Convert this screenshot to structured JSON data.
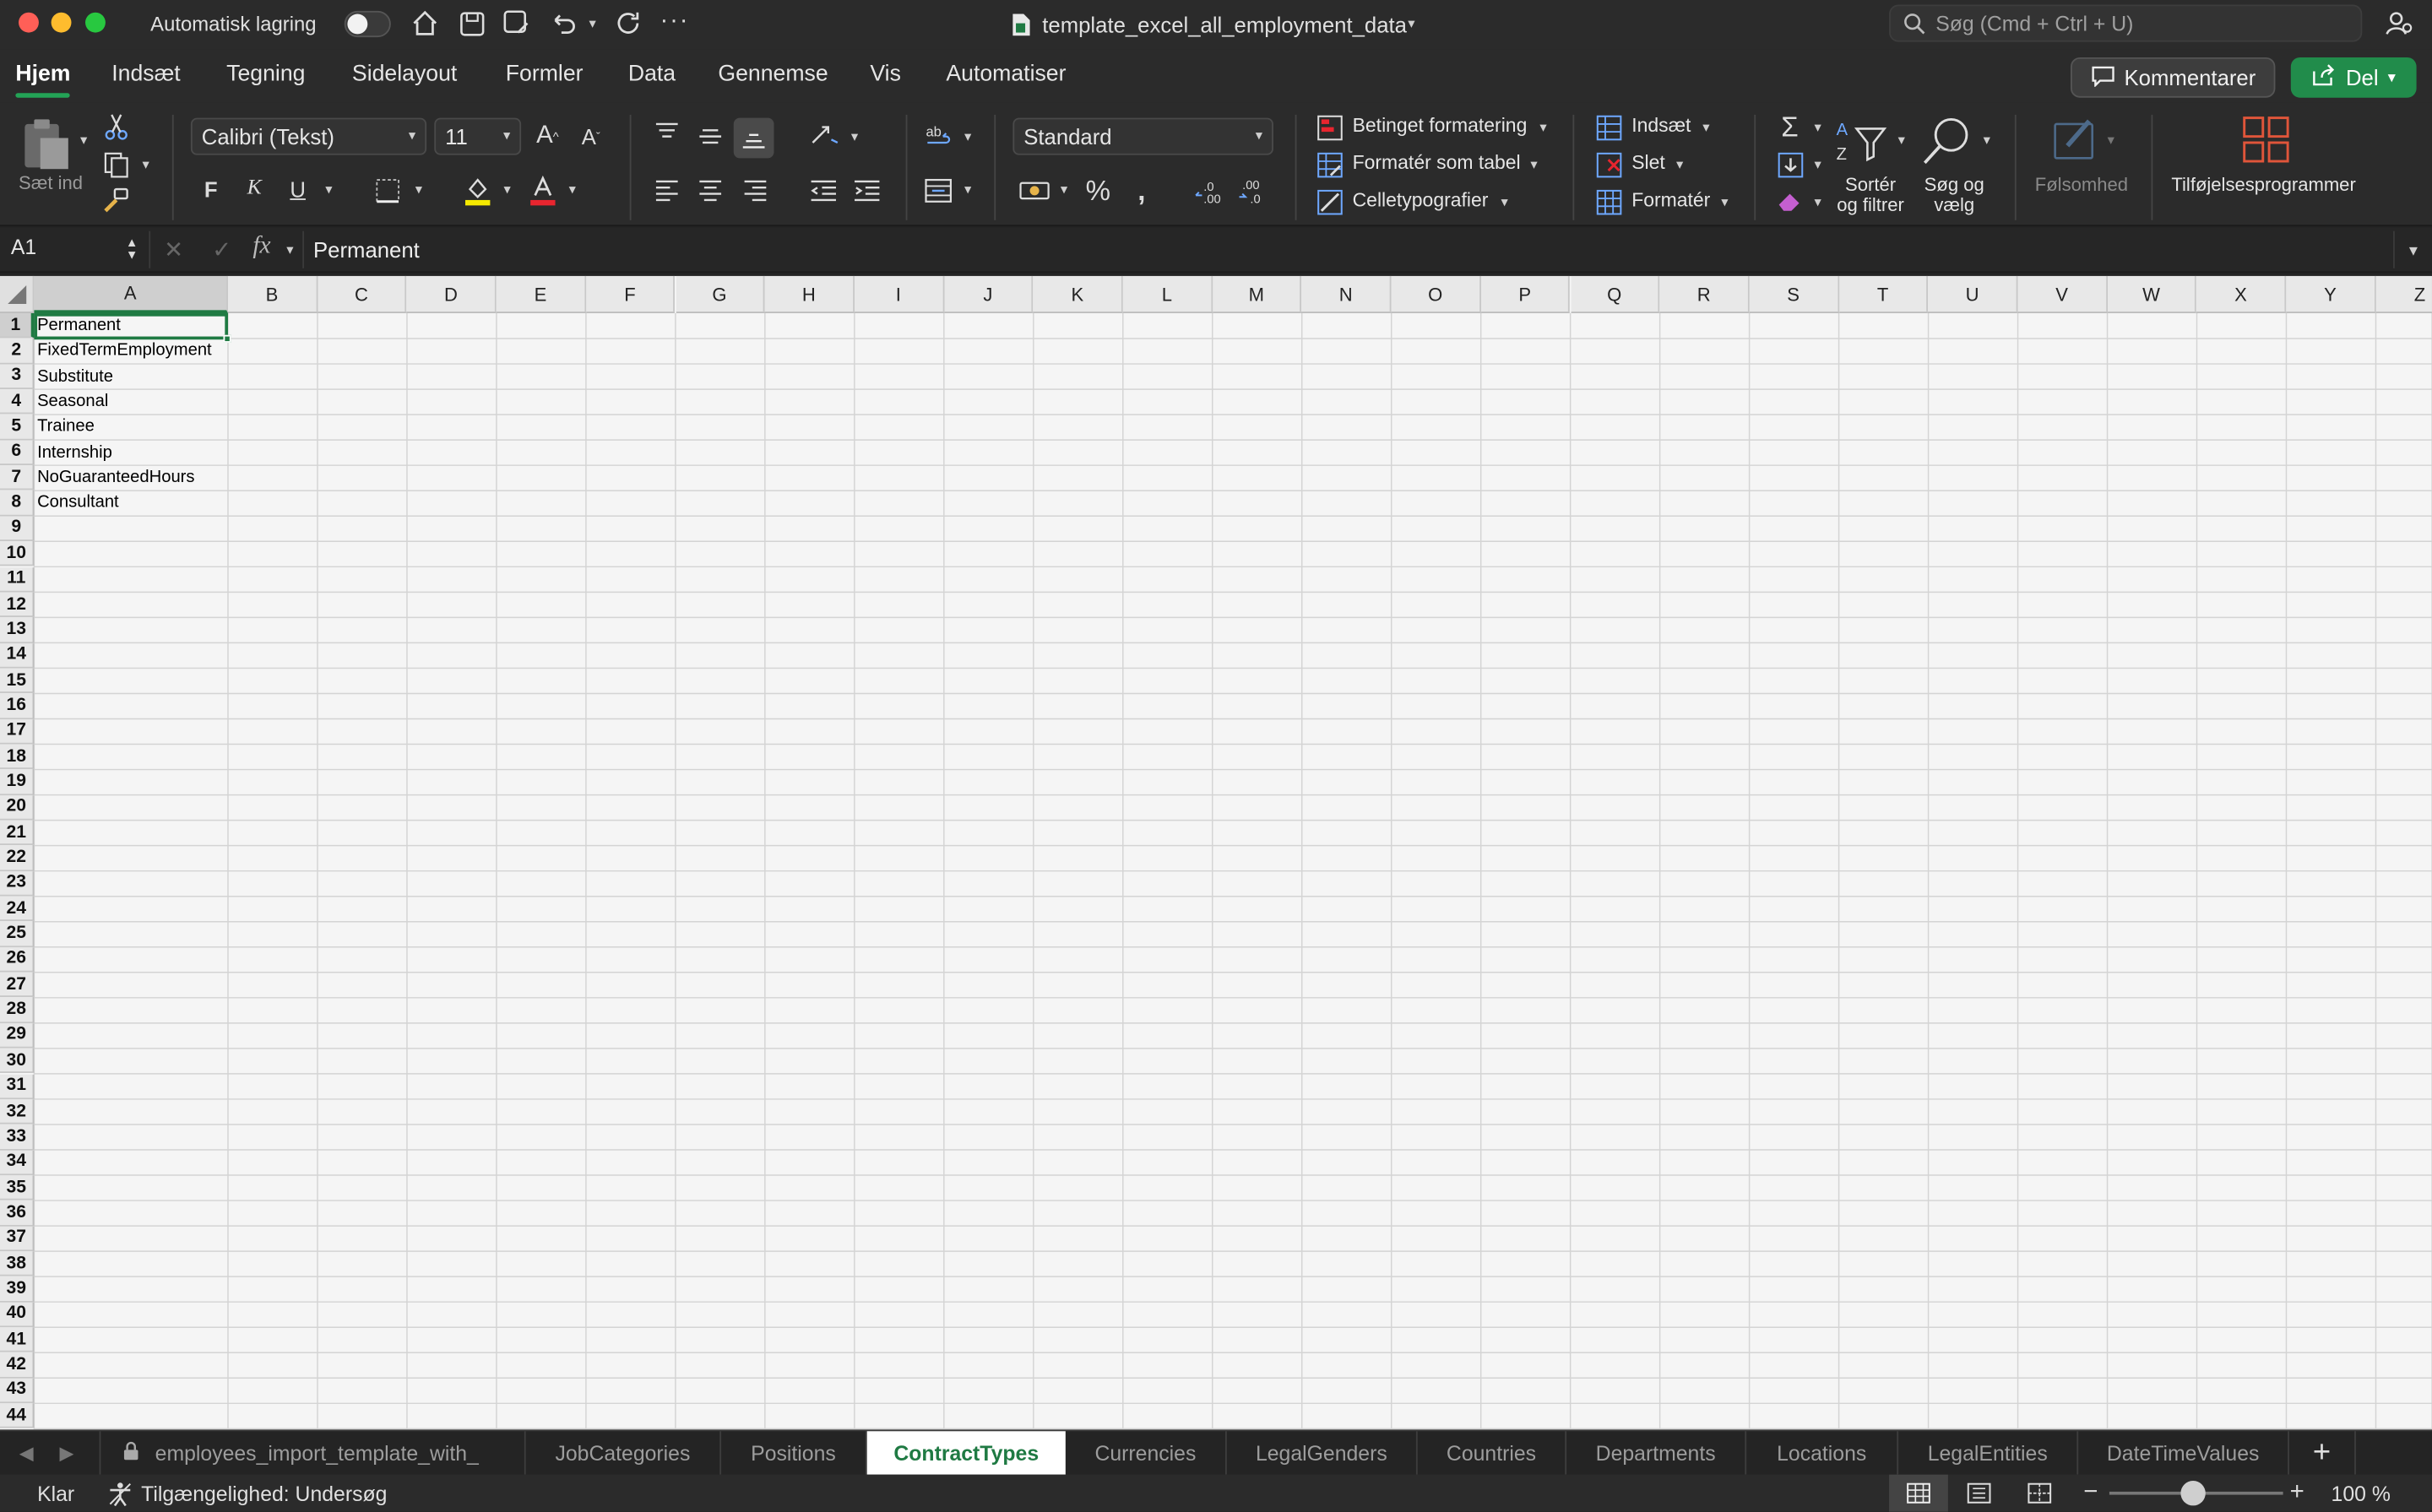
{
  "titlebar": {
    "autosave_label": "Automatisk lagring",
    "file_name": "template_excel_all_employment_data",
    "search_placeholder": "Søg (Cmd + Ctrl + U)"
  },
  "menu_tabs": [
    "Hjem",
    "Indsæt",
    "Tegning",
    "Sidelayout",
    "Formler",
    "Data",
    "Gennemse",
    "Vis",
    "Automatiser"
  ],
  "active_menu_tab": "Hjem",
  "buttons": {
    "comments": "Kommentarer",
    "share": "Del"
  },
  "ribbon": {
    "paste_label": "Sæt ind",
    "font_name": "Calibri (Tekst)",
    "font_size": "11",
    "bold": "F",
    "italic": "K",
    "underline": "U",
    "number_format": "Standard",
    "conditional_formatting": "Betinget formatering",
    "format_as_table": "Formatér som tabel",
    "cell_styles": "Celletypografier",
    "insert": "Indsæt",
    "delete": "Slet",
    "format": "Formatér",
    "sort_filter_line1": "Sortér",
    "sort_filter_line2": "og filtrer",
    "find_select_line1": "Søg og",
    "find_select_line2": "vælg",
    "sensitivity": "Følsomhed",
    "addins": "Tilføjelsesprogrammer"
  },
  "formula_bar": {
    "name_box": "A1",
    "fx": "fx",
    "content": "Permanent"
  },
  "columns": [
    "A",
    "B",
    "C",
    "D",
    "E",
    "F",
    "G",
    "H",
    "I",
    "J",
    "K",
    "L",
    "M",
    "N",
    "O",
    "P",
    "Q",
    "R",
    "S",
    "T",
    "U",
    "V",
    "W",
    "X",
    "Y",
    "Z"
  ],
  "row_count": 44,
  "cells": {
    "A1": "Permanent",
    "A2": "FixedTermEmployment",
    "A3": "Substitute",
    "A4": "Seasonal",
    "A5": "Trainee",
    "A6": "Internship",
    "A7": "NoGuaranteedHours",
    "A8": "Consultant"
  },
  "sheet_tabs": [
    "employees_import_template_with_",
    "JobCategories",
    "Positions",
    "ContractTypes",
    "Currencies",
    "LegalGenders",
    "Countries",
    "Departments",
    "Locations",
    "LegalEntities",
    "DateTimeValues"
  ],
  "active_sheet": "ContractTypes",
  "status": {
    "ready": "Klar",
    "accessibility": "Tilgængelighed: Undersøg",
    "zoom": "100 %"
  },
  "colors": {
    "accent_green": "#218c4b",
    "selection_green": "#1f7a43",
    "dark_bg": "#2b2b2b"
  }
}
